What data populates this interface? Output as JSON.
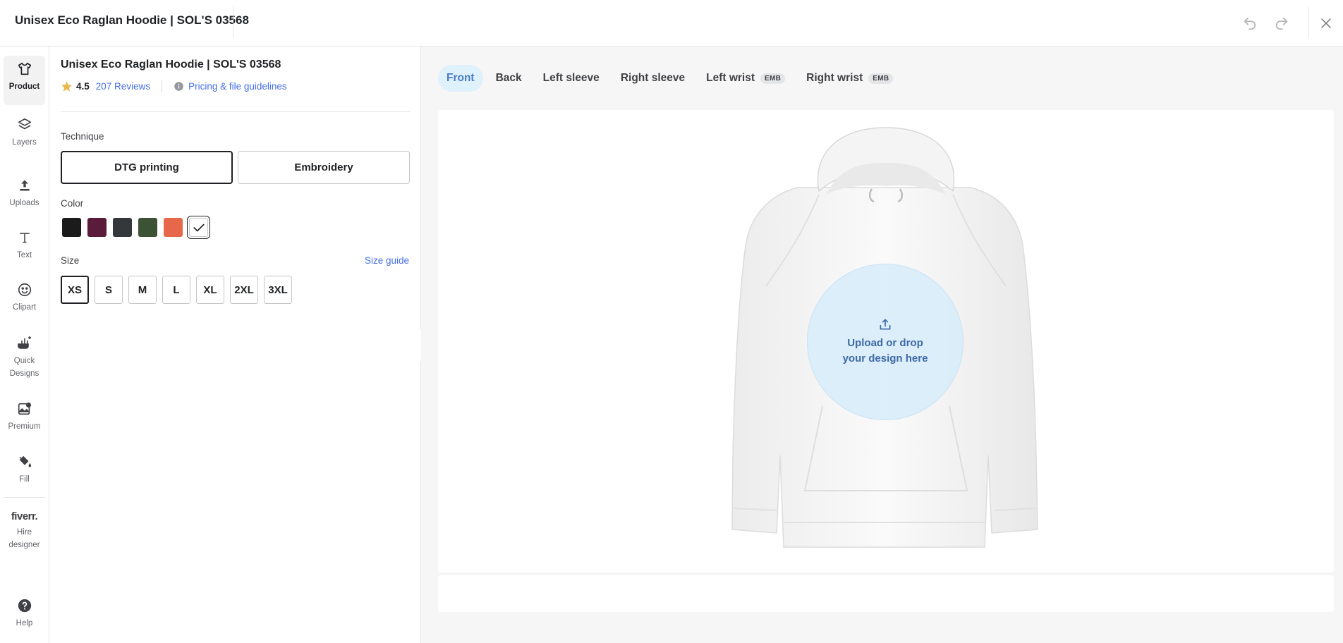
{
  "header": {
    "title": "Unisex Eco Raglan Hoodie | SOL'S 03568"
  },
  "rail": {
    "items": [
      {
        "label": "Product",
        "icon": "tshirt-icon"
      },
      {
        "label": "Layers",
        "icon": "layers-icon"
      },
      {
        "label": "Uploads",
        "icon": "upload-icon"
      },
      {
        "label": "Text",
        "icon": "text-icon"
      },
      {
        "label": "Clipart",
        "icon": "smiley-icon"
      },
      {
        "label": "Quick Designs",
        "icon": "magic-brush-icon"
      },
      {
        "label": "Premium",
        "icon": "premium-image-icon"
      },
      {
        "label": "Fill",
        "icon": "paint-bucket-icon"
      }
    ],
    "fiverr": {
      "logo": "fiverr.",
      "label": "Hire designer"
    },
    "help": {
      "label": "Help"
    }
  },
  "product": {
    "title": "Unisex Eco Raglan Hoodie | SOL'S 03568",
    "rating": "4.5",
    "reviews": "207 Reviews",
    "guidelines": "Pricing & file guidelines"
  },
  "technique": {
    "label": "Technique",
    "options": [
      "DTG printing",
      "Embroidery"
    ],
    "selected": "DTG printing"
  },
  "color": {
    "label": "Color",
    "swatches": [
      "#1b1b1b",
      "#5a1c3a",
      "#35383b",
      "#3b5235",
      "#e6674a",
      "#ffffff"
    ],
    "selected_index": 5
  },
  "size": {
    "label": "Size",
    "guide": "Size guide",
    "options": [
      "XS",
      "S",
      "M",
      "L",
      "XL",
      "2XL",
      "3XL"
    ],
    "selected": "XS"
  },
  "canvas": {
    "tabs": [
      {
        "label": "Front",
        "badge": ""
      },
      {
        "label": "Back",
        "badge": ""
      },
      {
        "label": "Left sleeve",
        "badge": ""
      },
      {
        "label": "Right sleeve",
        "badge": ""
      },
      {
        "label": "Left wrist",
        "badge": "EMB"
      },
      {
        "label": "Right wrist",
        "badge": "EMB"
      }
    ],
    "active_tab": "Front",
    "drop_text": "Upload or drop your design here"
  },
  "colors": {
    "accent_blue": "#446ee7",
    "active_tab_bg": "#dff1fb",
    "star": "#e8b84c"
  }
}
